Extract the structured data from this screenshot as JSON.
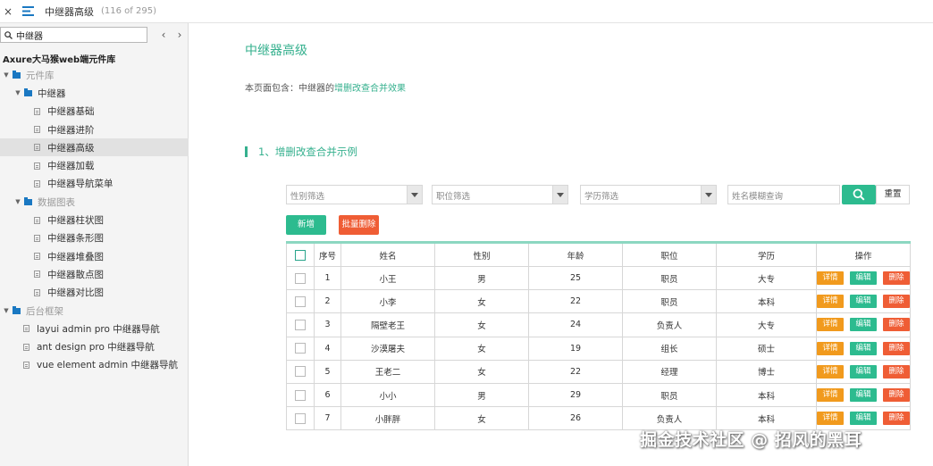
{
  "topbar": {
    "close": "×",
    "title": "中继器高级",
    "count": "(116 of 295)"
  },
  "sidebar": {
    "search_value": "中继器",
    "project": "Axure大马猴web端元件库",
    "tree": [
      {
        "label": "元件库",
        "level": 0,
        "type": "folder",
        "muted": true
      },
      {
        "label": "中继器",
        "level": 1,
        "type": "folder",
        "muted": false
      },
      {
        "label": "中继器基础",
        "level": 2,
        "type": "page"
      },
      {
        "label": "中继器进阶",
        "level": 2,
        "type": "page"
      },
      {
        "label": "中继器高级",
        "level": 2,
        "type": "page",
        "selected": true
      },
      {
        "label": "中继器加载",
        "level": 2,
        "type": "page"
      },
      {
        "label": "中继器导航菜单",
        "level": 2,
        "type": "page"
      },
      {
        "label": "数据图表",
        "level": 1,
        "type": "folder",
        "muted": true
      },
      {
        "label": "中继器柱状图",
        "level": 2,
        "type": "page"
      },
      {
        "label": "中继器条形图",
        "level": 2,
        "type": "page"
      },
      {
        "label": "中继器堆叠图",
        "level": 2,
        "type": "page"
      },
      {
        "label": "中继器散点图",
        "level": 2,
        "type": "page"
      },
      {
        "label": "中继器对比图",
        "level": 2,
        "type": "page"
      },
      {
        "label": "后台框架",
        "level": 0,
        "type": "folder",
        "muted": true
      },
      {
        "label": "layui admin pro 中继器导航",
        "level": 1,
        "type": "page"
      },
      {
        "label": "ant design pro 中继器导航",
        "level": 1,
        "type": "page"
      },
      {
        "label": "vue element admin 中继器导航",
        "level": 1,
        "type": "page"
      }
    ]
  },
  "main": {
    "title": "中继器高级",
    "desc_prefix": "本页面包含：中继器的",
    "desc_highlight": "增删改查合并效果",
    "section": "1、增删改查合并示例",
    "filters": {
      "gender_placeholder": "性别筛选",
      "job_placeholder": "职位筛选",
      "edu_placeholder": "学历筛选",
      "name_placeholder": "姓名模糊查询",
      "reset": "重置"
    },
    "add_label": "新增",
    "bulk_delete_label": "批量删除",
    "columns": [
      "序号",
      "姓名",
      "性别",
      "年龄",
      "职位",
      "学历",
      "操作"
    ],
    "op_labels": {
      "detail": "详情",
      "edit": "编辑",
      "del": "删除"
    },
    "rows": [
      {
        "no": "1",
        "name": "小王",
        "gender": "男",
        "age": "25",
        "job": "职员",
        "edu": "大专"
      },
      {
        "no": "2",
        "name": "小李",
        "gender": "女",
        "age": "22",
        "job": "职员",
        "edu": "本科"
      },
      {
        "no": "3",
        "name": "隔壁老王",
        "gender": "女",
        "age": "24",
        "job": "负责人",
        "edu": "大专"
      },
      {
        "no": "4",
        "name": "沙漠屠夫",
        "gender": "女",
        "age": "19",
        "job": "组长",
        "edu": "硕士"
      },
      {
        "no": "5",
        "name": "王老二",
        "gender": "女",
        "age": "22",
        "job": "经理",
        "edu": "博士"
      },
      {
        "no": "6",
        "name": "小小",
        "gender": "男",
        "age": "29",
        "job": "职员",
        "edu": "本科"
      },
      {
        "no": "7",
        "name": "小胖胖",
        "gender": "女",
        "age": "26",
        "job": "负责人",
        "edu": "本科"
      }
    ]
  },
  "watermark": "掘金技术社区 @ 招风的黑耳",
  "colors": {
    "accent": "#2dbb8f",
    "danger": "#ef5d35",
    "warning": "#f19a1d",
    "folder": "#1a78c2"
  }
}
